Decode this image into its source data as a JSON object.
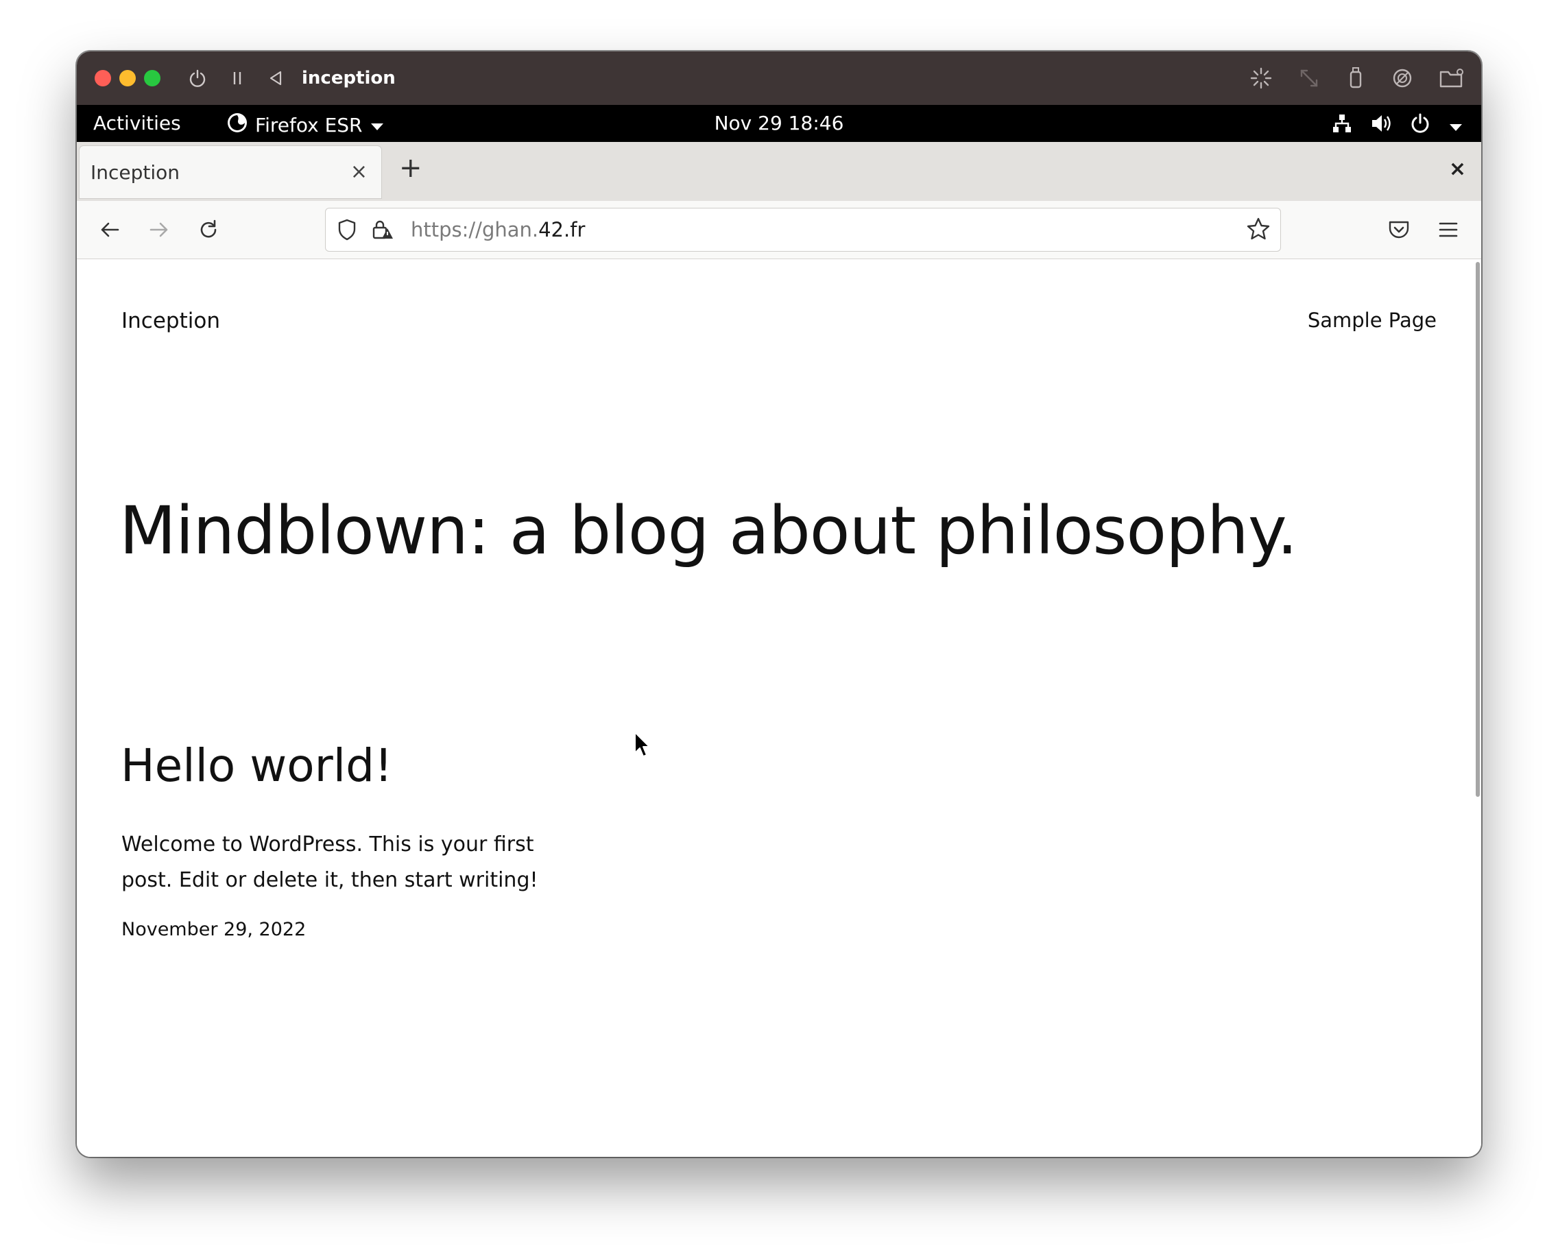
{
  "vm_window": {
    "title": "inception",
    "icons": [
      "power-icon",
      "pause-icon",
      "back-triangle-icon",
      "brightness-icon",
      "resize-icon",
      "usb-icon",
      "fingerprint-icon",
      "folder-icon"
    ]
  },
  "gnome_bar": {
    "activities": "Activities",
    "app_name": "Firefox ESR",
    "clock": "Nov 29  18:46",
    "tray_icons": [
      "network-icon",
      "volume-icon",
      "power-icon",
      "dropdown-icon"
    ]
  },
  "browser": {
    "tab": {
      "title": "Inception",
      "close": "×"
    },
    "new_tab": "+",
    "window_close": "×",
    "url": {
      "scheme_prefix": "https://ghan.",
      "host": "42.fr"
    }
  },
  "page": {
    "site_title": "Inception",
    "nav_link": "Sample Page",
    "hero": "Mindblown: a blog about philosophy.",
    "post": {
      "title": "Hello world!",
      "excerpt": "Welcome to WordPress. This is your first post. Edit or delete it, then start writing!",
      "date": "November 29, 2022"
    }
  },
  "colors": {
    "titlebar": "#3e3535",
    "gnome_bar": "#000000",
    "tabbar": "#e3e1de",
    "traffic_red": "#fe5f57",
    "traffic_yellow": "#febc2e",
    "traffic_green": "#28c840"
  }
}
